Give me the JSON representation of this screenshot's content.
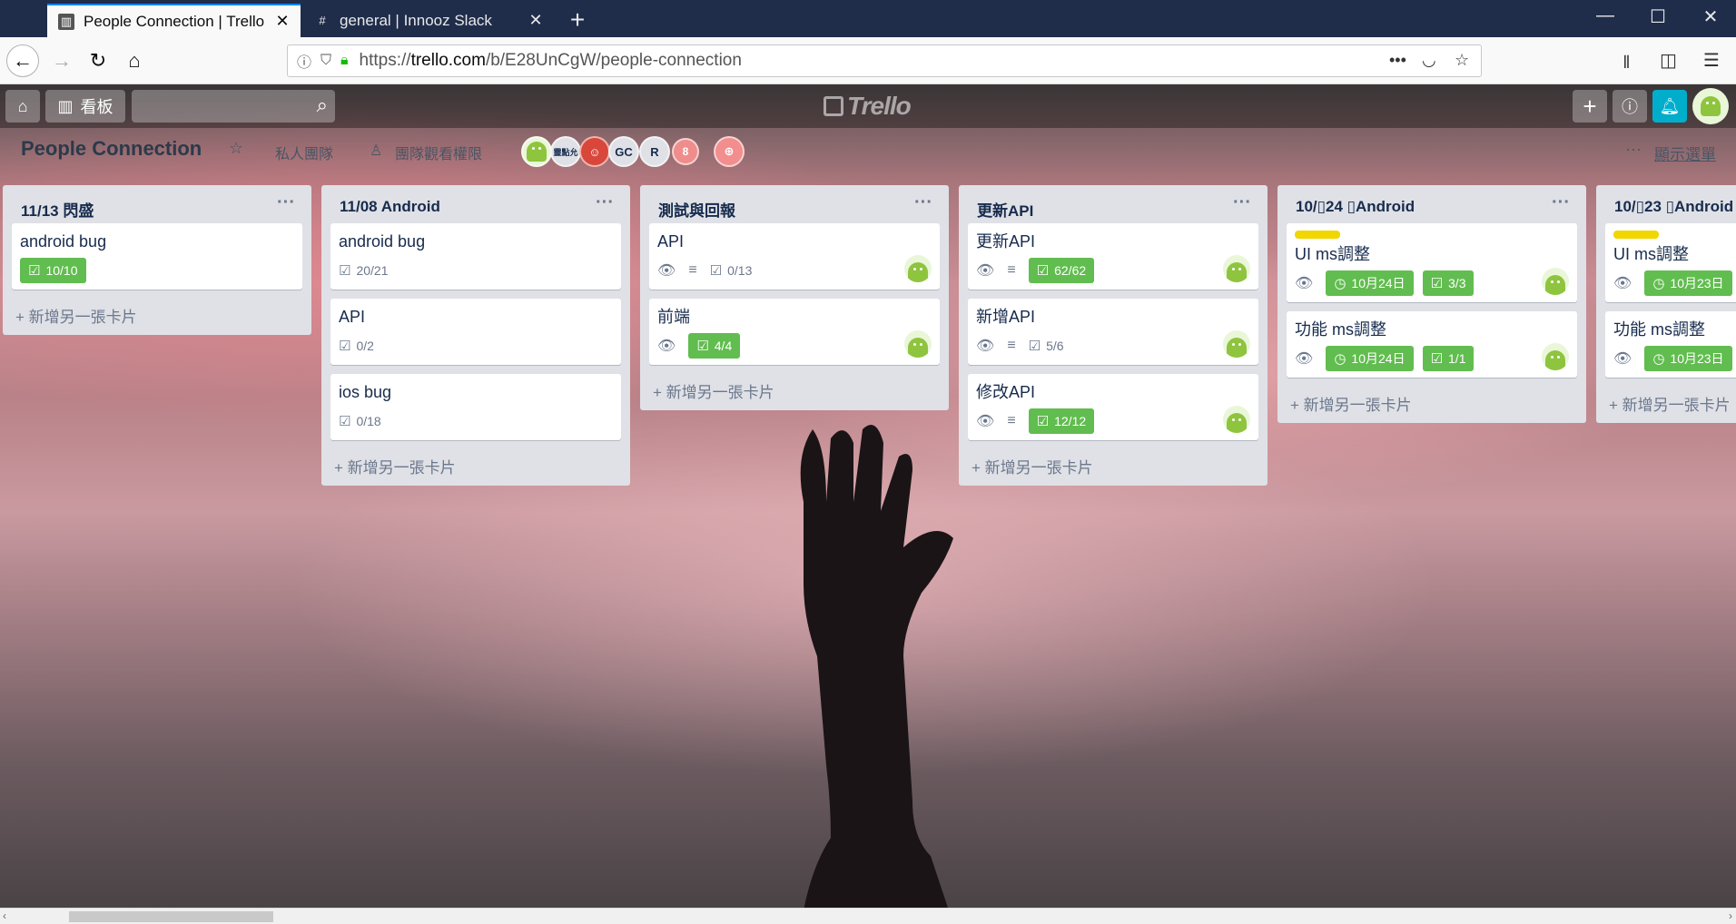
{
  "browser": {
    "tabs": [
      {
        "title": "People Connection | Trello",
        "favicon": "trello-icon",
        "active": true
      },
      {
        "title": "general | Innooz Slack",
        "favicon": "#",
        "active": false
      }
    ],
    "new_tab": "+",
    "window_controls": {
      "minimize": "—",
      "maximize": "☐",
      "close": "✕"
    },
    "url_prefix": "https://",
    "url_domain": "trello.com",
    "url_path": "/b/E28UnCgW/people-connection"
  },
  "trello": {
    "home_icon": "home-icon",
    "boards_label": "看板",
    "search_placeholder": "",
    "logo_text": "Trello",
    "board_name": "People Connection",
    "visibility": "私人團隊",
    "team_visibility": "團隊觀看權限",
    "members": [
      "GC",
      "R"
    ],
    "member_more": "8",
    "member_text_avatar": "靈點允",
    "show_menu": "顯示選單",
    "menu_dots": "···",
    "add_card": "新增另一張卡片",
    "lists": [
      {
        "title": "11/13 閃盛",
        "cards": [
          {
            "title": "android bug",
            "checklist": "10/10",
            "checklist_done": true
          }
        ]
      },
      {
        "title": "11/08 Android",
        "cards": [
          {
            "title": "android bug",
            "checklist": "20/21",
            "checklist_done": false
          },
          {
            "title": "API",
            "checklist": "0/2",
            "checklist_done": false
          },
          {
            "title": "ios bug",
            "checklist": "0/18",
            "checklist_done": false
          }
        ]
      },
      {
        "title": "測試與回報",
        "cards": [
          {
            "title": "API",
            "watch": true,
            "desc": true,
            "checklist": "0/13",
            "checklist_done": false,
            "avatar": true
          },
          {
            "title": "前端",
            "watch": true,
            "checklist": "4/4",
            "checklist_done": true,
            "avatar": true
          }
        ]
      },
      {
        "title": "更新API",
        "cards": [
          {
            "title": "更新API",
            "watch": true,
            "desc": true,
            "checklist": "62/62",
            "checklist_done": true,
            "avatar": true
          },
          {
            "title": "新增API",
            "watch": true,
            "desc": true,
            "checklist": "5/6",
            "checklist_done": false,
            "avatar": true
          },
          {
            "title": "修改API",
            "watch": true,
            "desc": true,
            "checklist": "12/12",
            "checklist_done": true,
            "avatar": true
          }
        ]
      },
      {
        "title": "10/▯24 ▯Android",
        "cards": [
          {
            "title": "UI ms調整",
            "label": true,
            "watch": true,
            "due": "10月24日",
            "checklist": "3/3",
            "checklist_done": true,
            "avatar": true
          },
          {
            "title": "功能 ms調整",
            "watch": true,
            "due": "10月24日",
            "checklist": "1/1",
            "checklist_done": true,
            "avatar": true
          }
        ]
      },
      {
        "title": "10/▯23 ▯Android",
        "cards": [
          {
            "title": "UI ms調整",
            "label": true,
            "watch": true,
            "due": "10月23日"
          },
          {
            "title": "功能 ms調整",
            "watch": true,
            "due": "10月23日"
          }
        ]
      }
    ]
  },
  "colors": {
    "trello_green": "#61bd4f",
    "label_yellow": "#f2d600",
    "bell_blue": "#00aecc",
    "list_bg": "#dfe1e6"
  }
}
